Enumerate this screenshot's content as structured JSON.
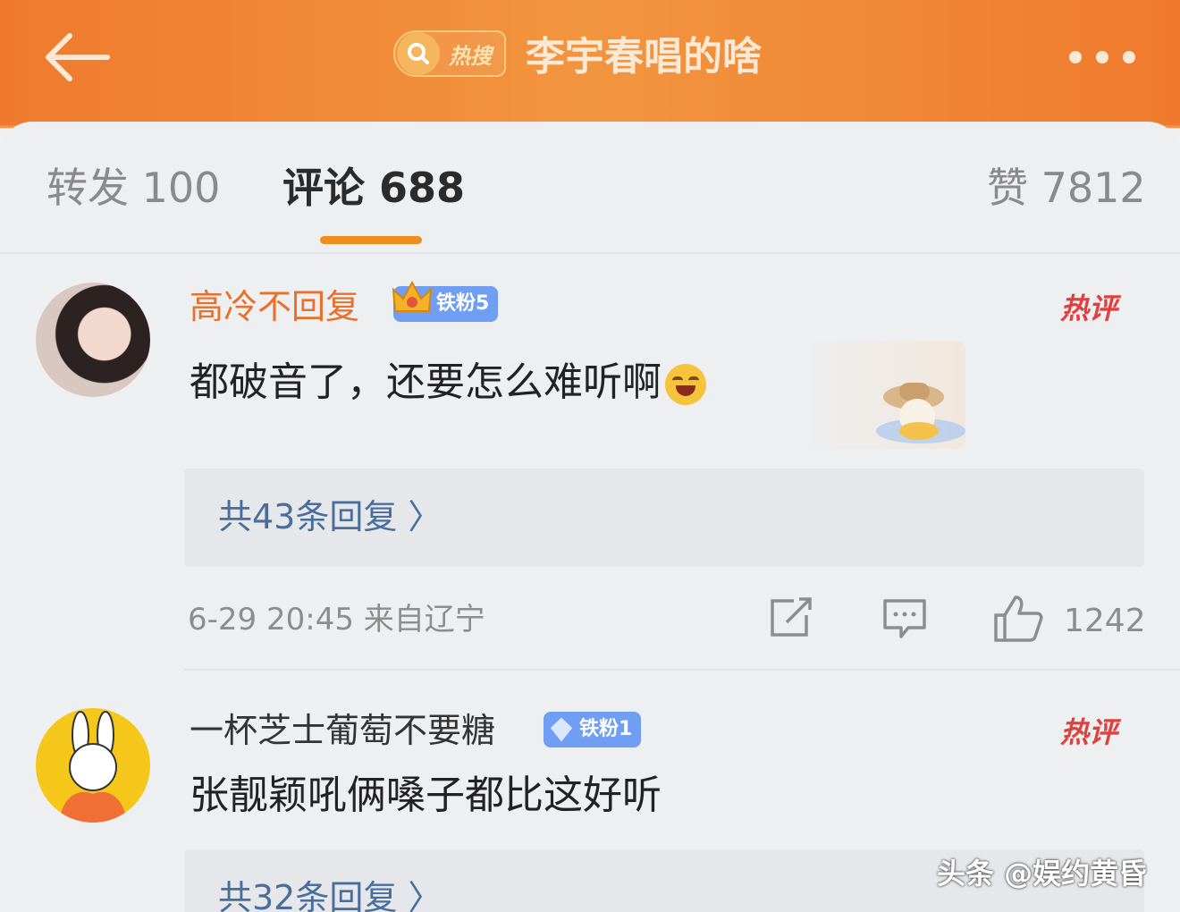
{
  "header": {
    "badge_label": "热搜",
    "title": "李宇春唱的啥"
  },
  "tabs": {
    "repost": "转发 100",
    "comments": "评论 688",
    "likes": "赞 7812"
  },
  "comments": [
    {
      "username": "高冷不回复",
      "fan_badge": "铁粉5",
      "hot_tag": "热评",
      "text": "都破音了，还要怎么难听啊",
      "emoji": "laughing-crying-emoji",
      "replies": "共43条回复 〉",
      "meta": "6-29 20:45 来自辽宁",
      "likes": "1242"
    },
    {
      "username": "一杯芝士葡萄不要糖",
      "fan_badge": "铁粉1",
      "hot_tag": "热评",
      "text": "张靓颖吼俩嗓子都比这好听",
      "replies": "共32条回复 〉"
    }
  ],
  "watermark": "头条 @娱约黄昏",
  "colors": {
    "header_orange": "#ef7a2e",
    "username_orange": "#e86f2c",
    "hot_red": "#e0403e",
    "link_blue": "#4a6e9b",
    "tab_underline": "#ee8e1e",
    "fan_badge_blue": "#6f9ef2"
  }
}
